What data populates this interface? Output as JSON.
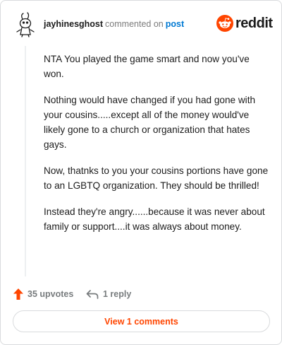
{
  "comment": {
    "author": "jayhinesghost",
    "action_text": "commented on",
    "post_link": "post",
    "paragraphs": [
      "NTA You played the game smart and now you've won.",
      "Nothing would have changed if you had gone with your cousins.....except all of the money would've likely gone to a church or organization that hates gays.",
      "Now, thatnks to you your cousins portions have gone to an LGBTQ organization. They should be thrilled!",
      "Instead they're angry......because it was never about family or support....it was always about money."
    ]
  },
  "brand": {
    "name": "reddit",
    "icon": "reddit-logo-icon",
    "color": "#ff4500"
  },
  "actions": {
    "upvotes_label": "35 upvotes",
    "reply_label": "1 reply",
    "upvote_icon": "upvote-arrow-icon",
    "reply_icon": "reply-arrow-icon",
    "upvote_color": "#ff4500"
  },
  "footer": {
    "view_comments_label": "View 1 comments"
  }
}
